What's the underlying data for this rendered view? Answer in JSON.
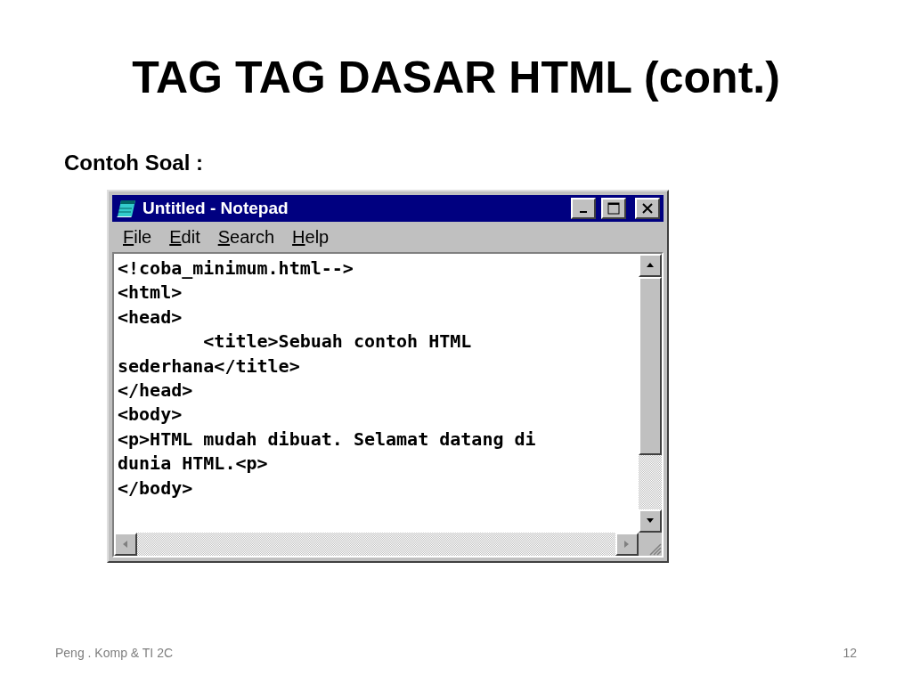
{
  "slide": {
    "title": "TAG TAG DASAR HTML (cont.)",
    "subtitle": "Contoh Soal :",
    "footer": "Peng . Komp & TI 2C",
    "page_number": "12"
  },
  "window": {
    "title": "Untitled - Notepad",
    "menu": [
      "File",
      "Edit",
      "Search",
      "Help"
    ],
    "lines": [
      "<!coba_minimum.html-->",
      "<html>",
      "<head>",
      "        <title>Sebuah contoh HTML",
      "sederhana</title>",
      "</head>",
      "<body>",
      "<p>HTML mudah dibuat. Selamat datang di",
      "dunia HTML.<p>",
      "</body>"
    ]
  }
}
